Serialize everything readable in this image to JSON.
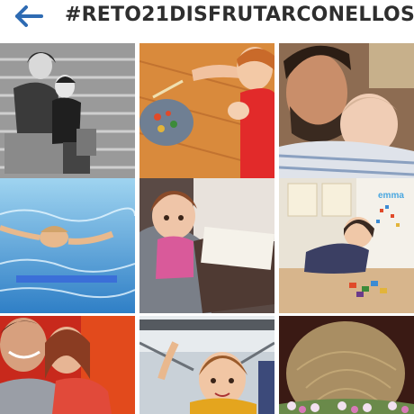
{
  "header": {
    "back_icon": "arrow-left-icon",
    "title": "#RETO21DISFRUTARCONELLOS",
    "accent_color": "#2e6bb3"
  },
  "grid": {
    "tile_count": 9,
    "photos": [
      {
        "description": "photo-mother-and-child-on-stairs"
      },
      {
        "description": "photo-child-painting-on-floor"
      },
      {
        "description": "photo-father-with-baby"
      },
      {
        "description": "photo-child-swimming"
      },
      {
        "description": "photo-girl-on-sofa"
      },
      {
        "description": "photo-child-playing-with-magnets"
      },
      {
        "description": "photo-mother-and-daughter-selfie"
      },
      {
        "description": "photo-girl-on-bridge"
      },
      {
        "description": "photo-baby-head-with-flowers"
      }
    ],
    "tile4_caption": "",
    "tile6_wall_text": "emma"
  }
}
